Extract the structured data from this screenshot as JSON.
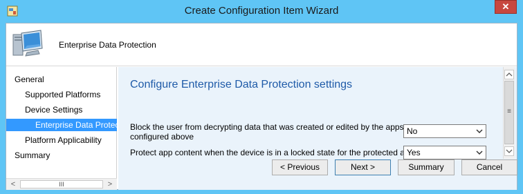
{
  "window": {
    "title": "Create Configuration Item Wizard",
    "close_glyph": "✕",
    "icon": "wizard-app-icon"
  },
  "header": {
    "title": "Enterprise Data Protection",
    "icon": "computer-icon"
  },
  "nav": {
    "items": [
      {
        "label": "General"
      },
      {
        "label": "Supported Platforms"
      },
      {
        "label": "Device Settings"
      },
      {
        "label": "Enterprise Data Protec"
      },
      {
        "label": "Platform Applicability"
      },
      {
        "label": "Summary"
      }
    ],
    "selected_index": 3,
    "scroll_left": "<",
    "scroll_right": ">",
    "scroll_thumb": "III"
  },
  "content": {
    "section_title": "Configure Enterprise Data Protection settings",
    "settings": [
      {
        "label_line1": "Block the user from decrypting data that was created or edited by the apps",
        "label_line2": "configured above",
        "value": "No"
      },
      {
        "label_line1": "Protect app content when the device is in a locked state for the protected apps.",
        "label_line2": "",
        "value": "Yes"
      }
    ],
    "scroll_up": "^",
    "scroll_down": "v",
    "scroll_grip": "≡"
  },
  "buttons": {
    "previous": "< Previous",
    "next": "Next >",
    "summary": "Summary",
    "cancel": "Cancel"
  },
  "colors": {
    "titlebar": "#5fc5f5",
    "selection": "#3399ff",
    "section_title": "#1e5aa8",
    "content_bg": "#eaf3fb",
    "close_button": "#c7473f"
  }
}
